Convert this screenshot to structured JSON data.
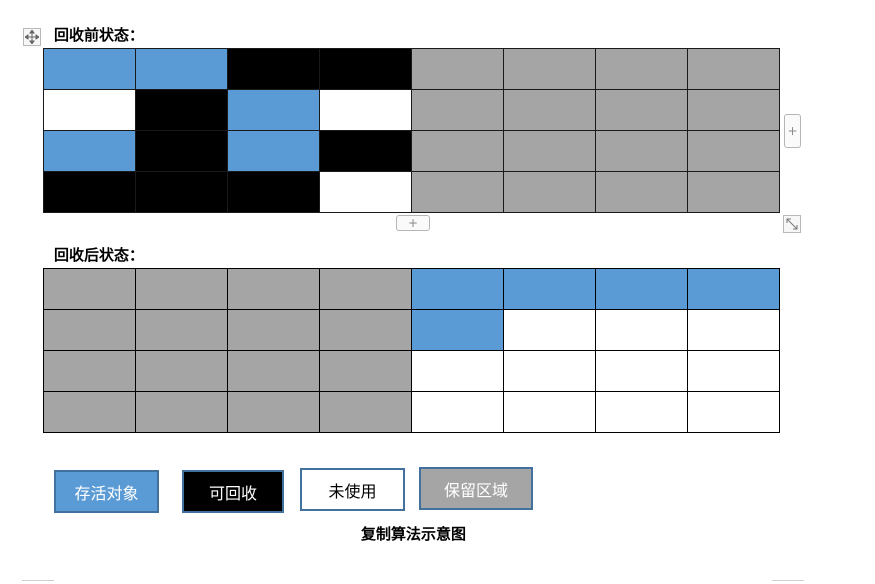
{
  "labels": {
    "before": "回收前状态：",
    "after": "回收后状态："
  },
  "colors": {
    "live": "#5b9bd5",
    "reclaimable": "#000000",
    "unused": "#ffffff",
    "reserved": "#a5a5a5"
  },
  "grid_before": [
    [
      "live",
      "live",
      "reclaimable",
      "reclaimable",
      "reserved",
      "reserved",
      "reserved",
      "reserved"
    ],
    [
      "unused",
      "reclaimable",
      "live",
      "unused",
      "reserved",
      "reserved",
      "reserved",
      "reserved"
    ],
    [
      "live",
      "reclaimable",
      "live",
      "reclaimable",
      "reserved",
      "reserved",
      "reserved",
      "reserved"
    ],
    [
      "reclaimable",
      "reclaimable",
      "reclaimable",
      "unused",
      "reserved",
      "reserved",
      "reserved",
      "reserved"
    ]
  ],
  "grid_after": [
    [
      "reserved",
      "reserved",
      "reserved",
      "reserved",
      "live",
      "live",
      "live",
      "live"
    ],
    [
      "reserved",
      "reserved",
      "reserved",
      "reserved",
      "live",
      "unused",
      "unused",
      "unused"
    ],
    [
      "reserved",
      "reserved",
      "reserved",
      "reserved",
      "unused",
      "unused",
      "unused",
      "unused"
    ],
    [
      "reserved",
      "reserved",
      "reserved",
      "reserved",
      "unused",
      "unused",
      "unused",
      "unused"
    ]
  ],
  "controls": {
    "add_row": "+",
    "add_col": "+"
  },
  "legend": {
    "live": "存活对象",
    "reclaimable": "可回收",
    "unused": "未使用",
    "reserved": "保留区域"
  },
  "caption": "复制算法示意图"
}
